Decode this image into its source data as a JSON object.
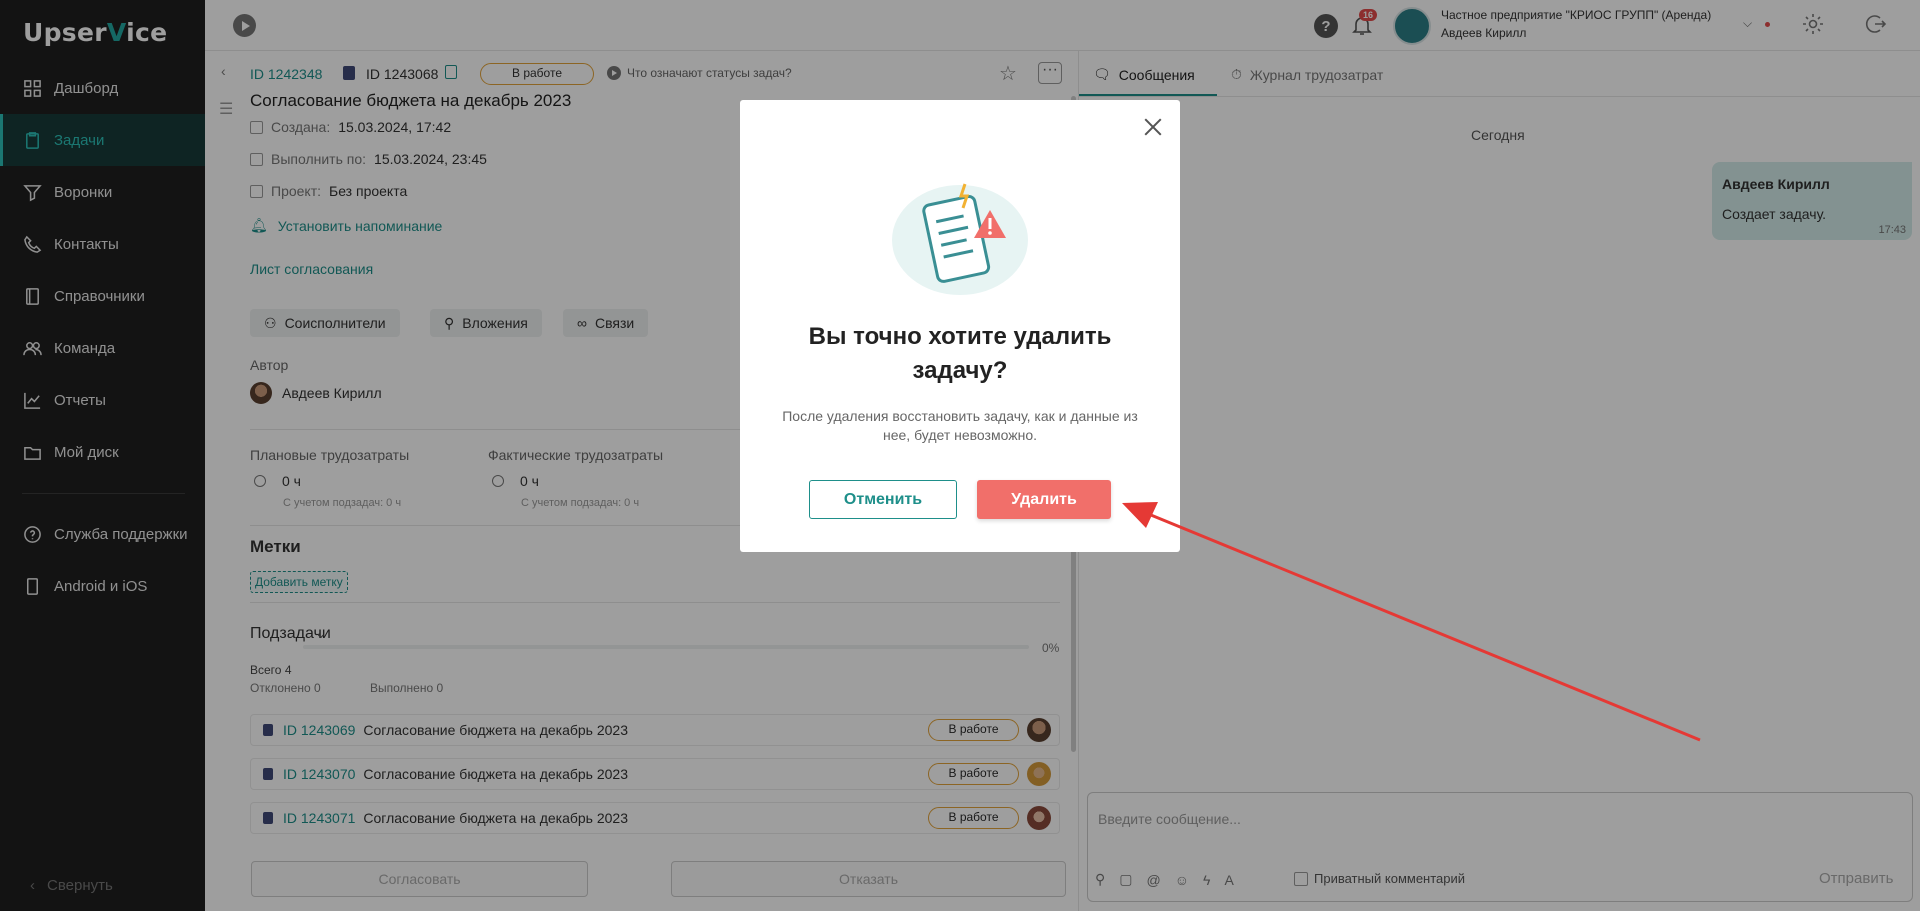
{
  "sidebar": {
    "logo_prefix": "Upser",
    "logo_accent": "V",
    "logo_suffix": "ice",
    "items": [
      {
        "label": "Дашборд",
        "icon": "dashboard-icon"
      },
      {
        "label": "Задачи",
        "icon": "tasks-icon"
      },
      {
        "label": "Воронки",
        "icon": "funnel-icon"
      },
      {
        "label": "Контакты",
        "icon": "phone-icon"
      },
      {
        "label": "Справочники",
        "icon": "book-icon"
      },
      {
        "label": "Команда",
        "icon": "team-icon"
      },
      {
        "label": "Отчеты",
        "icon": "chart-icon"
      },
      {
        "label": "Мой диск",
        "icon": "folder-icon"
      }
    ],
    "bottom_items": [
      {
        "label": "Служба поддержки",
        "icon": "help-circle-icon"
      },
      {
        "label": "Android и iOS",
        "icon": "mobile-icon"
      }
    ],
    "collapse_label": "Свернуть",
    "active_index": 1
  },
  "topbar": {
    "help_label": "?",
    "notifications_count": "16",
    "org_name": "Частное предприятие \"КРИОС ГРУПП\" (Аренда)",
    "user_name": "Авдеев Кирилл"
  },
  "task": {
    "parent_id": "ID 1242348",
    "id": "ID 1243068",
    "status": "В работе",
    "status_help": "Что означают статусы задач?",
    "title": "Согласование бюджета на декабрь 2023",
    "created_label": "Создана:",
    "created_value": "15.03.2024, 17:42",
    "due_label": "Выполнить по:",
    "due_value": "15.03.2024, 23:45",
    "project_label": "Проект:",
    "project_value": "Без проекта",
    "reminder": "Установить напоминание",
    "approval_sheet": "Лист согласования",
    "chips": [
      "Соисполнители",
      "Вложения",
      "Связи"
    ],
    "author_label": "Автор",
    "author_name": "Авдеев Кирилл",
    "planned_label": "Плановые трудозатраты",
    "planned_value": "0 ч",
    "planned_sub": "С учетом подзадач: 0 ч",
    "actual_label": "Фактические трудозатраты",
    "actual_value": "0 ч",
    "actual_sub": "С учетом подзадач: 0 ч",
    "tags_title": "Метки",
    "add_tag": "Добавить метку",
    "subtasks_title": "Подзадачи",
    "subtasks_total_label": "Всего",
    "subtasks_total": "4",
    "subtasks_rejected": "Отклонено 0",
    "subtasks_done": "Выполнено 0",
    "subtasks_percent": "0%",
    "subtasks_progress": 0,
    "subtasks": [
      {
        "id": "ID 1243069",
        "name": "Согласование бюджета на декабрь 2023",
        "status": "В работе"
      },
      {
        "id": "ID 1243070",
        "name": "Согласование бюджета на декабрь 2023",
        "status": "В работе"
      },
      {
        "id": "ID 1243071",
        "name": "Согласование бюджета на декабрь 2023",
        "status": "В работе"
      }
    ],
    "approve_btn": "Согласовать",
    "reject_btn": "Отказать"
  },
  "chat": {
    "tab_messages": "Сообщения",
    "tab_log": "Журнал трудозатрат",
    "today": "Сегодня",
    "message": {
      "author": "Авдеев Кирилл",
      "text": "Создает задачу.",
      "time": "17:43"
    },
    "input_placeholder": "Введите сообщение...",
    "private_label": "Приватный комментарий",
    "send_label": "Отправить"
  },
  "modal": {
    "title": "Вы точно хотите удалить задачу?",
    "text": "После удаления восстановить задачу, как и данные из нее, будет невозможно.",
    "cancel": "Отменить",
    "delete": "Удалить"
  },
  "colors": {
    "accent": "#1e8f8a",
    "sidebar_bg": "#1f1f1f",
    "danger": "#f16f6a",
    "status_border": "#e3a33b",
    "annotation_arrow": "#e53935"
  }
}
